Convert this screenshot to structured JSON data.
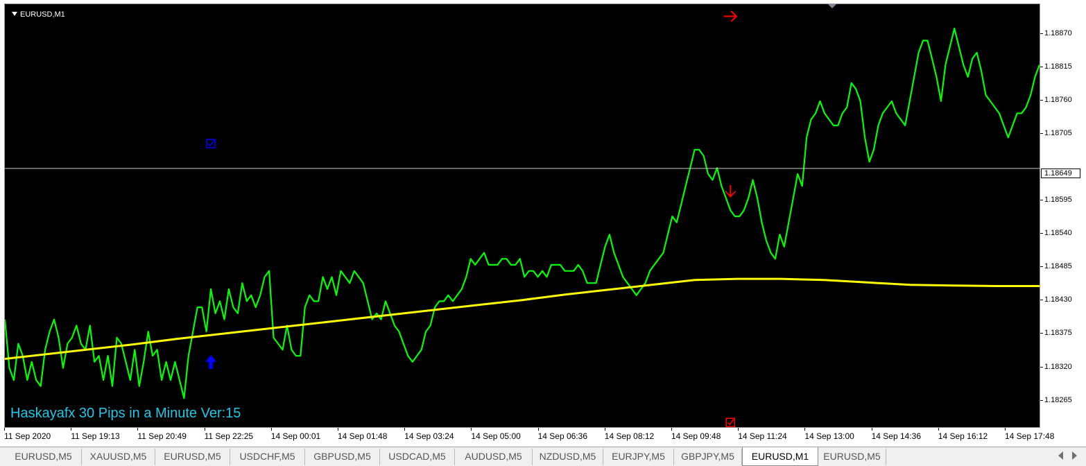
{
  "window": {
    "symbol_title": "EURUSD,M1",
    "indicator_label": "Haskayafx 30 Pips in a Minute Ver:15"
  },
  "colors": {
    "background": "#000000",
    "price_line": "#00ff00",
    "moving_average": "#ffff00",
    "buy_signal": "#0000ff",
    "sell_signal": "#ff0000",
    "indicator_text": "#1ec8e8"
  },
  "chart_data": {
    "type": "line",
    "title": "EURUSD,M1",
    "ylim": [
      1.1822,
      1.1892
    ],
    "current_price": "1.18649",
    "y_ticks": [
      "1.18870",
      "1.18815",
      "1.18760",
      "1.18705",
      "1.18595",
      "1.18540",
      "1.18485",
      "1.18430",
      "1.18375",
      "1.18320",
      "1.18265"
    ],
    "x_ticks": [
      "11 Sep 2020",
      "11 Sep 19:13",
      "11 Sep 20:49",
      "11 Sep 22:25",
      "14 Sep 00:01",
      "14 Sep 01:48",
      "14 Sep 03:24",
      "14 Sep 05:00",
      "14 Sep 06:36",
      "14 Sep 08:12",
      "14 Sep 09:48",
      "14 Sep 11:24",
      "14 Sep 13:00",
      "14 Sep 14:36",
      "14 Sep 16:12",
      "14 Sep 17:48"
    ],
    "series": [
      {
        "values": [
          1.184,
          1.1832,
          1.183,
          1.1836,
          1.1834,
          1.183,
          1.1833,
          1.183,
          1.1829,
          1.1835,
          1.1838,
          1.184,
          1.1837,
          1.1832,
          1.1836,
          1.1837,
          1.1839,
          1.1836,
          1.1835,
          1.1839,
          1.1833,
          1.1834,
          1.183,
          1.1834,
          1.1829,
          1.1837,
          1.1836,
          1.1833,
          1.183,
          1.1835,
          1.1829,
          1.1833,
          1.1838,
          1.1834,
          1.1835,
          1.183,
          1.1833,
          1.183,
          1.1833,
          1.183,
          1.1827,
          1.1834,
          1.1838,
          1.1842,
          1.1842,
          1.1838,
          1.1845,
          1.1841,
          1.1843,
          1.184,
          1.1845,
          1.1842,
          1.1841,
          1.1846,
          1.1843,
          1.1844,
          1.1842,
          1.1844,
          1.1847,
          1.1848,
          1.1837,
          1.1836,
          1.1835,
          1.1839,
          1.1835,
          1.1834,
          1.1834,
          1.1842,
          1.1844,
          1.1843,
          1.1843,
          1.1847,
          1.1845,
          1.1847,
          1.1844,
          1.1848,
          1.1847,
          1.1846,
          1.1848,
          1.1847,
          1.1846,
          1.1843,
          1.184,
          1.1841,
          1.184,
          1.1843,
          1.1841,
          1.1839,
          1.1838,
          1.1836,
          1.1834,
          1.1833,
          1.1834,
          1.1835,
          1.1838,
          1.1839,
          1.1842,
          1.1843,
          1.1843,
          1.1844,
          1.1843,
          1.1844,
          1.1845,
          1.1847,
          1.185,
          1.1849,
          1.185,
          1.1851,
          1.1849,
          1.1849,
          1.1849,
          1.185,
          1.185,
          1.1849,
          1.1849,
          1.185,
          1.1847,
          1.1848,
          1.1848,
          1.1847,
          1.1848,
          1.1847,
          1.1849,
          1.1849,
          1.1849,
          1.1848,
          1.1848,
          1.1848,
          1.1849,
          1.1848,
          1.1846,
          1.1846,
          1.1846,
          1.1849,
          1.1852,
          1.1854,
          1.1851,
          1.1849,
          1.1847,
          1.1846,
          1.1845,
          1.1844,
          1.1845,
          1.1846,
          1.1848,
          1.1849,
          1.185,
          1.1851,
          1.1854,
          1.1857,
          1.1856,
          1.1859,
          1.1862,
          1.1865,
          1.1868,
          1.1868,
          1.1867,
          1.1864,
          1.1863,
          1.1865,
          1.1862,
          1.186,
          1.1858,
          1.1857,
          1.1857,
          1.1858,
          1.186,
          1.1863,
          1.186,
          1.1856,
          1.1853,
          1.1851,
          1.185,
          1.1854,
          1.1852,
          1.1856,
          1.186,
          1.1864,
          1.1862,
          1.187,
          1.1873,
          1.1874,
          1.1876,
          1.1874,
          1.1873,
          1.1872,
          1.1872,
          1.1874,
          1.1875,
          1.1879,
          1.1878,
          1.1876,
          1.187,
          1.1866,
          1.1868,
          1.1872,
          1.1874,
          1.1875,
          1.1876,
          1.1874,
          1.1873,
          1.1872,
          1.1876,
          1.188,
          1.1884,
          1.1886,
          1.1886,
          1.1883,
          1.188,
          1.1876,
          1.1882,
          1.1885,
          1.1888,
          1.1885,
          1.1882,
          1.188,
          1.1883,
          1.1884,
          1.1881,
          1.1877,
          1.1876,
          1.1875,
          1.1874,
          1.1872,
          1.187,
          1.1872,
          1.1874,
          1.1874,
          1.1875,
          1.1877,
          1.188,
          1.1882
        ]
      },
      {
        "values": [
          1.18335,
          1.18343,
          1.18351,
          1.18359,
          1.18368,
          1.18376,
          1.18384,
          1.18392,
          1.184,
          1.18408,
          1.18416,
          1.18424,
          1.18432,
          1.18441,
          1.18449,
          1.18457,
          1.18465,
          1.18467,
          1.18467,
          1.18465,
          1.18461,
          1.18457,
          1.18456,
          1.18455,
          1.18455
        ]
      }
    ],
    "markers": [
      {
        "name": "buy-arrow",
        "x_index": 46,
        "y": 1.1833
      },
      {
        "name": "sell-arrow",
        "x_index": 162,
        "y": 1.1861
      },
      {
        "name": "sell-arrow-top",
        "x_index": 162,
        "y": 1.189
      },
      {
        "name": "buy-checkbox",
        "x_index": 46,
        "y": 1.1869
      },
      {
        "name": "sell-checkbox",
        "x_index": 162,
        "y": 1.1823
      }
    ]
  },
  "tabs": [
    {
      "label": "EURUSD,M5",
      "active": false
    },
    {
      "label": "XAUUSD,M5",
      "active": false
    },
    {
      "label": "EURUSD,M5",
      "active": false
    },
    {
      "label": "USDCHF,M5",
      "active": false
    },
    {
      "label": "GBPUSD,M5",
      "active": false
    },
    {
      "label": "USDCAD,M5",
      "active": false
    },
    {
      "label": "AUDUSD,M5",
      "active": false
    },
    {
      "label": "NZDUSD,M5",
      "active": false
    },
    {
      "label": "EURJPY,M5",
      "active": false
    },
    {
      "label": "GBPJPY,M5",
      "active": false
    },
    {
      "label": "EURUSD,M1",
      "active": true
    },
    {
      "label": "EURUSD,M5",
      "active": false
    }
  ]
}
